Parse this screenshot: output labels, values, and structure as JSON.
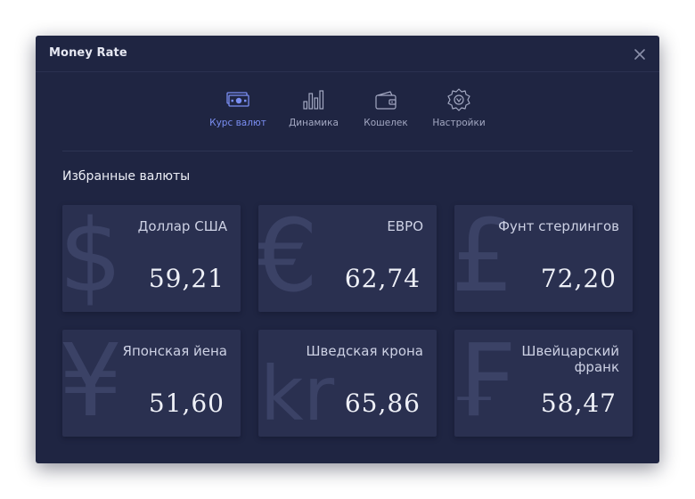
{
  "app": {
    "title": "Money Rate"
  },
  "window": {
    "close_icon": "close-icon"
  },
  "nav": {
    "items": [
      {
        "label": "Курс валют",
        "icon": "money-icon",
        "active": true
      },
      {
        "label": "Динамика",
        "icon": "bar-chart-icon",
        "active": false
      },
      {
        "label": "Кошелек",
        "icon": "wallet-icon",
        "active": false
      },
      {
        "label": "Настройки",
        "icon": "settings-gear-icon",
        "active": false
      }
    ]
  },
  "favorites": {
    "title": "Избранные валюты",
    "cards": [
      {
        "symbol": "$",
        "name": "Доллар США",
        "rate": "59,21"
      },
      {
        "symbol": "€",
        "name": "ЕВРО",
        "rate": "62,74"
      },
      {
        "symbol": "£",
        "name": "Фунт стерлингов",
        "rate": "72,20"
      },
      {
        "symbol": "¥",
        "name": "Японская йена",
        "rate": "51,60"
      },
      {
        "symbol": "kr",
        "name": "Шведская крона",
        "rate": "65,86"
      },
      {
        "symbol": "₣",
        "name": "Швейцарский франк",
        "rate": "58,47"
      }
    ]
  },
  "colors": {
    "window_bg": "#1f2542",
    "card_bg": "#2a3050",
    "accent": "#7a8ef2",
    "symbol": "#3b4266"
  }
}
